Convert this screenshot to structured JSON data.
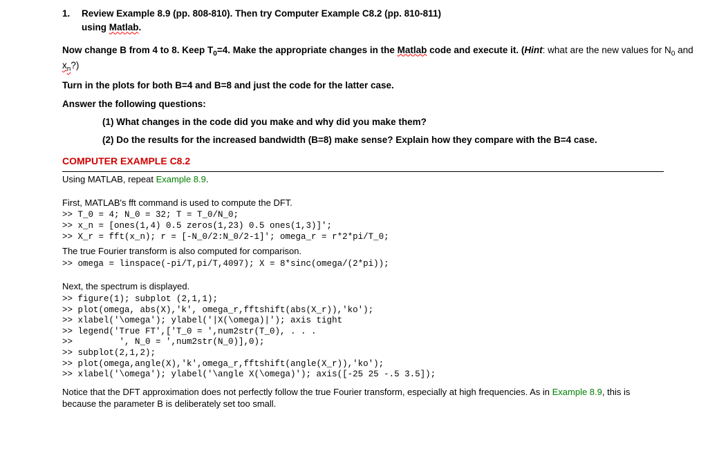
{
  "q1": {
    "num": "1.",
    "line1_pre": "Review Example 8.9 (pp. 808-810). Then try Computer Example C8.2 (pp. 810-811)",
    "line2_pre": "using ",
    "line2_wavy": "Matlab",
    "line2_post": "."
  },
  "p1": {
    "seg1": "Now change B from 4 to 8. Keep T",
    "sub1": "0",
    "seg2": "=4. Make the appropriate changes in the ",
    "wavy": "Matlab",
    "seg3": " code and execute it. (",
    "hint": "Hint",
    "seg4": ": what are the new values for N",
    "subN": "0",
    "seg5": " and ",
    "wavy2": "x",
    "subx": "n",
    "seg6": "?)"
  },
  "p2": "Turn in the plots for both B=4 and B=8 and just the code for the latter case.",
  "p3": "Answer the following questions:",
  "sub1": "(1) What changes in the code did you make and why did you make them?",
  "sub2": "(2) Do the results for the increased bandwidth (B=8) make sense? Explain how they compare with the B=4 case.",
  "ce_title": "COMPUTER EXAMPLE C8.2",
  "ce_line": {
    "pre": "Using MATLAB, repeat ",
    "green": "Example 8.9",
    "post": "."
  },
  "s1": "First, MATLAB's fft command is used to compute the DFT.",
  "code1": ">> T_0 = 4; N_0 = 32; T = T_0/N_0;\n>> x_n = [ones(1,4) 0.5 zeros(1,23) 0.5 ones(1,3)]';\n>> X_r = fft(x_n); r = [-N_0/2:N_0/2-1]'; omega_r = r*2*pi/T_0;",
  "s2": "The true Fourier transform is also computed for comparison.",
  "code2": ">> omega = linspace(-pi/T,pi/T,4097); X = 8*sinc(omega/(2*pi));",
  "s3": "Next, the spectrum is displayed.",
  "code3": ">> figure(1); subplot (2,1,1);\n>> plot(omega, abs(X),'k', omega_r,fftshift(abs(X_r)),'ko');\n>> xlabel('\\omega'); ylabel('|X(\\omega)|'); axis tight\n>> legend('True FT',['T_0 = ',num2str(T_0), . . .\n>>         ', N_0 = ',num2str(N_0)],0);\n>> subplot(2,1,2);\n>> plot(omega,angle(X),'k',omega_r,fftshift(angle(X_r)),'ko');\n>> xlabel('\\omega'); ylabel('\\angle X(\\omega)'); axis([-25 25 -.5 3.5]);",
  "note": {
    "pre": "Notice that the DFT approximation does not perfectly follow the true Fourier transform, especially at high frequencies. As in ",
    "green": "Example 8.9",
    "post": ", this is because the parameter B is deliberately set too small."
  }
}
